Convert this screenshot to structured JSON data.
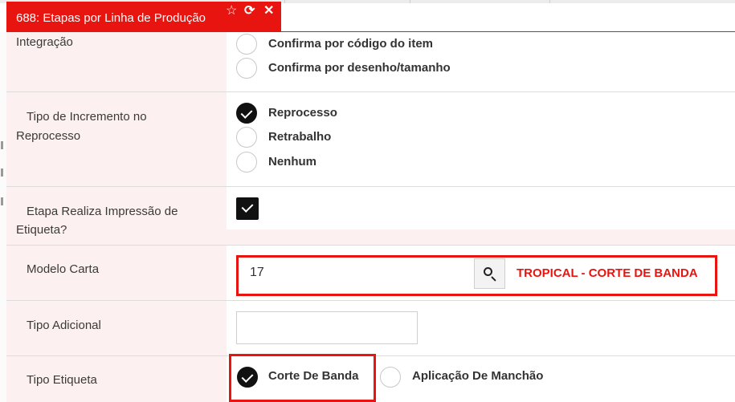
{
  "tab": {
    "title": "688: Etapas por Linha de Produção",
    "icons": [
      "star-icon",
      "refresh-icon",
      "close-icon"
    ],
    "star_glyph": "☆",
    "refresh_glyph": "⟳",
    "close_glyph": "✕"
  },
  "colors": {
    "accent": "#e8140f",
    "label_bg": "#fdf0f0",
    "check": "#111111"
  },
  "form": {
    "integracao": {
      "label": "Integração",
      "options": [
        {
          "label": "Confirma por código do item",
          "selected": false
        },
        {
          "label": "Confirma por desenho/tamanho",
          "selected": false
        }
      ]
    },
    "tipo_incremento": {
      "label_line1": "Tipo de Incremento no",
      "label_line2": "Reprocesso",
      "options": [
        {
          "label": "Reprocesso",
          "selected": true
        },
        {
          "label": "Retrabalho",
          "selected": false
        },
        {
          "label": "Nenhum",
          "selected": false
        }
      ]
    },
    "impressao_etiqueta": {
      "label_line1": "Etapa Realiza Impressão de",
      "label_line2": "Etiqueta?",
      "checked": true
    },
    "modelo_carta": {
      "label": "Modelo Carta",
      "value": "17",
      "description": "TROPICAL - CORTE DE BANDA"
    },
    "tipo_adicional": {
      "label": "Tipo Adicional",
      "value": ""
    },
    "tipo_etiqueta": {
      "label": "Tipo Etiqueta",
      "options": [
        {
          "label": "Corte De Banda",
          "selected": true
        },
        {
          "label": "Aplicação De Manchão",
          "selected": false
        }
      ]
    }
  }
}
